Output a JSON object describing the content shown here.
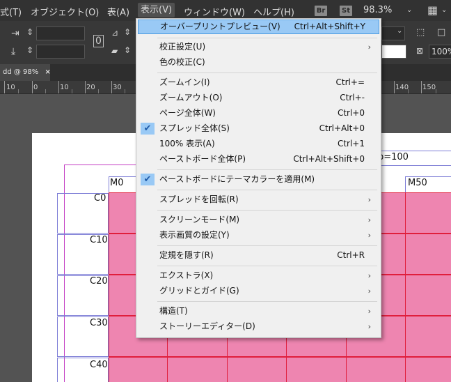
{
  "menubar": {
    "items": [
      "式(T)",
      "オブジェクト(O)",
      "表(A)",
      "表示(V)",
      "ウィンドウ(W)",
      "ヘルプ(H)"
    ],
    "badges": [
      "Br",
      "St"
    ],
    "zoom": "98.3%"
  },
  "toolbar": {
    "right_value": "100%"
  },
  "document_tab": {
    "label": "dd @ 98%",
    "close": "×"
  },
  "ruler": {
    "ticks": [
      "10",
      "0",
      "10",
      "20",
      "30",
      "140",
      "150"
    ]
  },
  "document": {
    "header_text": "p=100",
    "column_labels": [
      "M0",
      "M50"
    ],
    "row_labels": [
      "C0",
      "C10",
      "C20",
      "C30",
      "C40"
    ],
    "swatch_color": "#ee85b0"
  },
  "view_menu": {
    "items": [
      {
        "label": "オーバープリントプレビュー(V)",
        "shortcut": "Ctrl+Alt+Shift+Y",
        "highlighted": true
      },
      {
        "label": "校正設定(U)",
        "submenu": true
      },
      {
        "label": "色の校正(C)"
      },
      {
        "label": "ズームイン(I)",
        "shortcut": "Ctrl+="
      },
      {
        "label": "ズームアウト(O)",
        "shortcut": "Ctrl+-"
      },
      {
        "label": "ページ全体(W)",
        "shortcut": "Ctrl+0"
      },
      {
        "label": "スプレッド全体(S)",
        "shortcut": "Ctrl+Alt+0",
        "checked": true
      },
      {
        "label": "100% 表示(A)",
        "shortcut": "Ctrl+1"
      },
      {
        "label": "ペーストボード全体(P)",
        "shortcut": "Ctrl+Alt+Shift+0"
      },
      {
        "label": "ペーストボードにテーマカラーを適用(M)",
        "checked": true
      },
      {
        "label": "スプレッドを回転(R)",
        "submenu": true
      },
      {
        "label": "スクリーンモード(M)",
        "submenu": true
      },
      {
        "label": "表示画質の設定(Y)",
        "submenu": true
      },
      {
        "label": "定規を隠す(R)",
        "shortcut": "Ctrl+R"
      },
      {
        "label": "エクストラ(X)",
        "submenu": true
      },
      {
        "label": "グリッドとガイド(G)",
        "submenu": true
      },
      {
        "label": "構造(T)",
        "submenu": true
      },
      {
        "label": "ストーリーエディター(D)",
        "submenu": true
      }
    ]
  }
}
